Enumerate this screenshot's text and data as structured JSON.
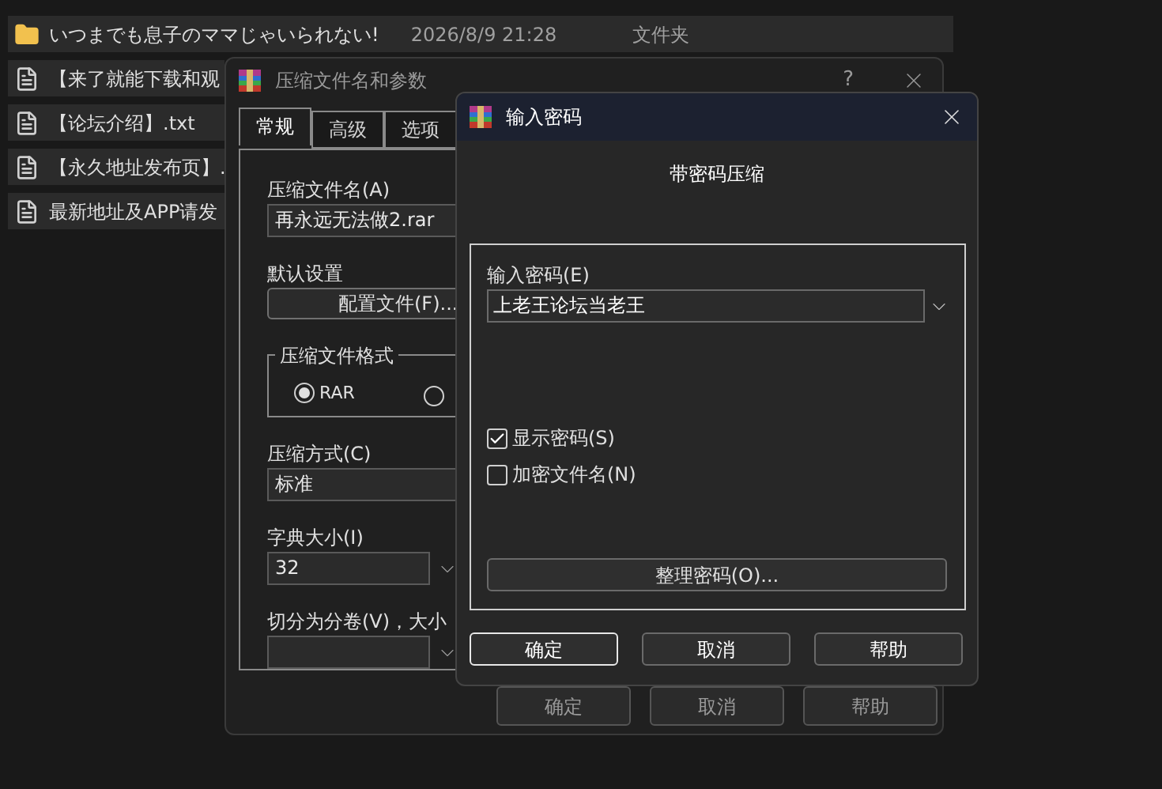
{
  "file_list": {
    "rows": [
      {
        "kind": "folder",
        "name": "いつまでも息子のママじゃいられない!",
        "date": "2026/8/9 21:28",
        "type": "文件夹"
      },
      {
        "kind": "file",
        "name": "【来了就能下载和观"
      },
      {
        "kind": "file",
        "name": "【论坛介绍】.txt"
      },
      {
        "kind": "file",
        "name": "【永久地址发布页】."
      },
      {
        "kind": "file",
        "name": "最新地址及APP请发"
      }
    ]
  },
  "archive_dialog": {
    "title": "压缩文件名和参数",
    "help": "?",
    "tabs": [
      {
        "label": "常规",
        "selected": true
      },
      {
        "label": "高级",
        "selected": false
      },
      {
        "label": "选项",
        "selected": false
      }
    ],
    "archive_name_label": "压缩文件名(A)",
    "archive_name": "再永远无法做2.rar",
    "defaults_label": "默认设置",
    "profiles_button": "配置文件(F)...",
    "format_group": "压缩文件格式",
    "formats": [
      {
        "label": "RAR",
        "selected": true
      },
      {
        "selected": false
      }
    ],
    "method_label": "压缩方式(C)",
    "method": "标准",
    "dict_label": "字典大小(I)",
    "dict": "32",
    "split_label": "切分为分卷(V)，大小",
    "buttons": [
      "确定",
      "取消",
      "帮助"
    ]
  },
  "password_dialog": {
    "title": "输入密码",
    "heading": "带密码压缩",
    "password_label": "输入密码(E)",
    "password": "上老王论坛当老王",
    "options": [
      {
        "label": "显示密码(S)",
        "checked": true
      },
      {
        "label": "加密文件名(N)",
        "checked": false
      }
    ],
    "organize_button": "整理密码(O)...",
    "buttons": [
      {
        "label": "确定",
        "selected": true
      },
      {
        "label": "取消",
        "selected": false
      },
      {
        "label": "帮助",
        "selected": false
      }
    ]
  }
}
